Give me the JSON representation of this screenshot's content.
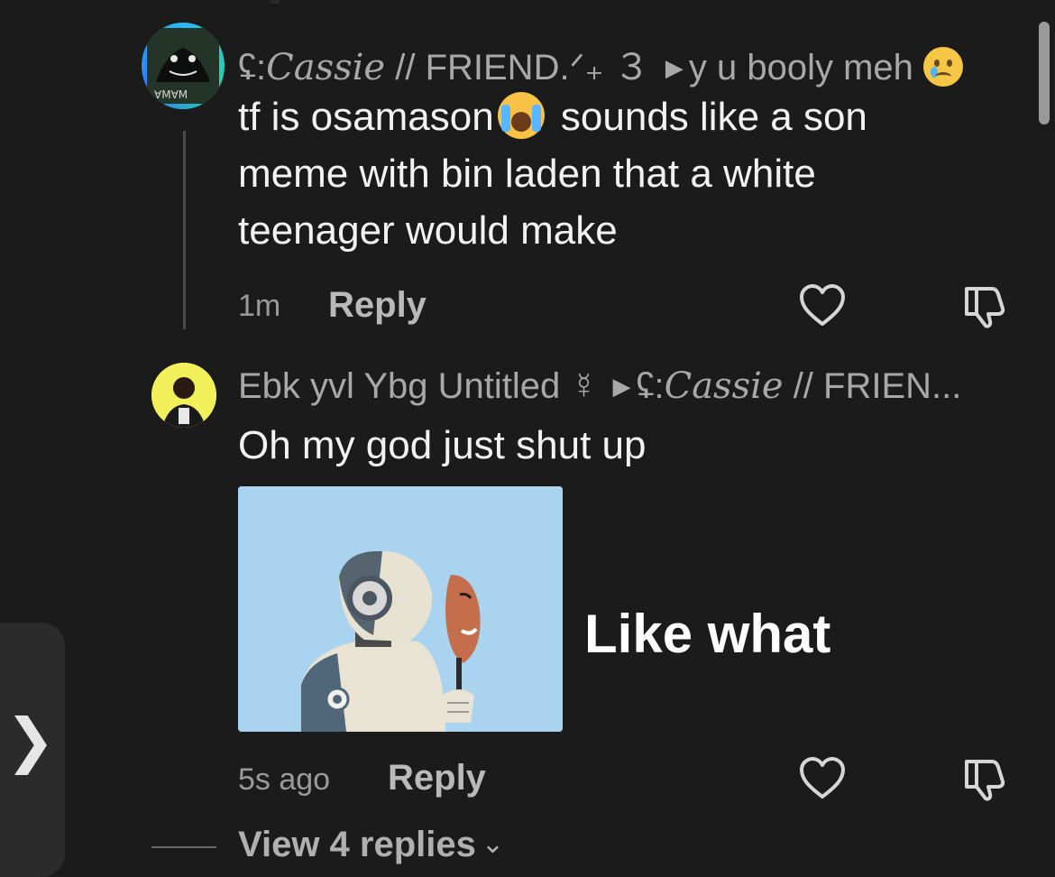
{
  "comments": [
    {
      "username_prefix": "ʢ:",
      "username_fancy": "Cassie",
      "username_suffix": " // FRIEND.ᐟ₊ ３",
      "reply_to": "y u booly meh",
      "text_before_emoji": "tf is osamason",
      "text_after_emoji": " sounds like a son meme with bin laden that a white teenager would make",
      "timestamp": "1m",
      "reply_label": "Reply"
    },
    {
      "username": "Ebk yvl Ybg Untitled ☿",
      "reply_to_prefix": "ʢ:",
      "reply_to_fancy": "Cassie",
      "reply_to_suffix": " // FRIEN...",
      "text": "Oh my god just shut up",
      "image_caption": "Like what",
      "timestamp": "5s ago",
      "reply_label": "Reply"
    }
  ],
  "view_replies": {
    "label": "View 4 replies"
  },
  "icons": {
    "like": "heart-icon",
    "dislike": "thumbs-down-icon",
    "side_tab": "chevron-right-icon",
    "arrow": "triangle-right-icon"
  },
  "colors": {
    "background": "#1b1b1b",
    "avatar_ring": "#29b9f0",
    "avatar2_bg": "#f1f05a",
    "meme_bg": "#a9d3ee"
  }
}
